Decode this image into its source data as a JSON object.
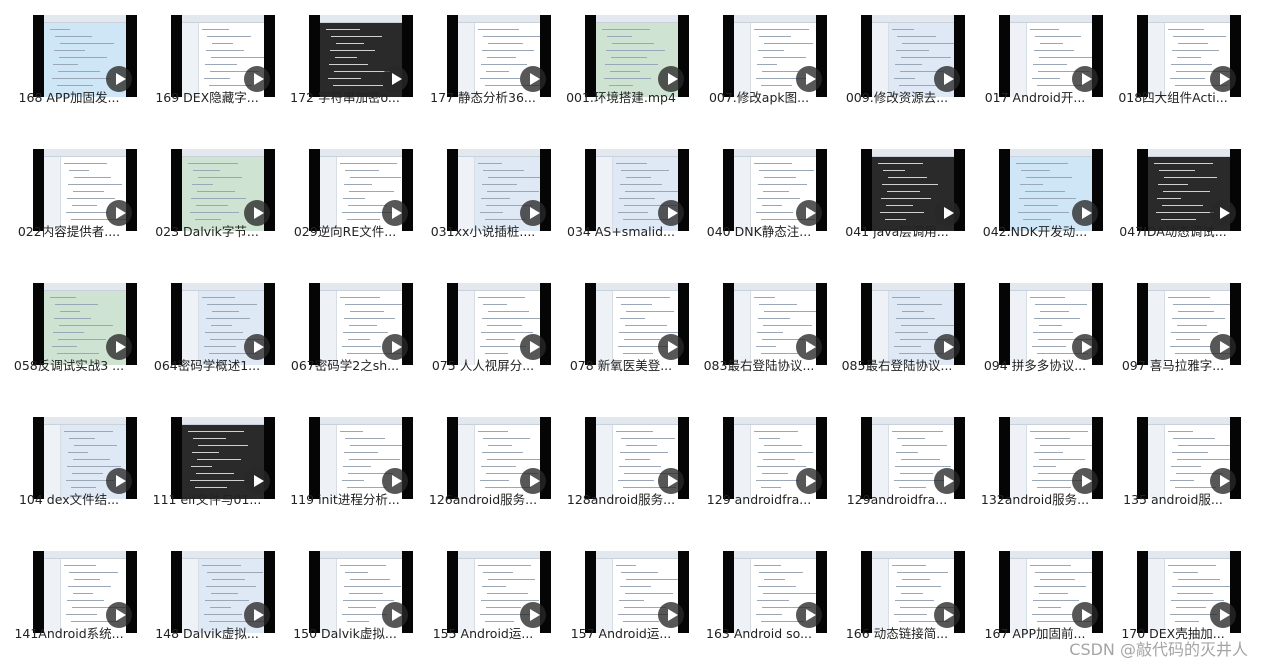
{
  "files": [
    {
      "caption": "168 APP加固发...",
      "variant": 5
    },
    {
      "caption": "169 DEX隐藏字...",
      "variant": 2
    },
    {
      "caption": "172 字符串加密o...",
      "variant": 4
    },
    {
      "caption": "177 静态分析36...",
      "variant": 2
    },
    {
      "caption": "001.环境搭建.mp4",
      "variant": 3
    },
    {
      "caption": "007.修改apk图...",
      "variant": 2
    },
    {
      "caption": "009.修改资源去...",
      "variant": 1
    },
    {
      "caption": "017 Android开...",
      "variant": 2
    },
    {
      "caption": "018四大组件Acti...",
      "variant": 2
    },
    {
      "caption": "022内容提供者....",
      "variant": 2
    },
    {
      "caption": "023 Dalvik字节...",
      "variant": 3
    },
    {
      "caption": "029逆向RE文件...",
      "variant": 2
    },
    {
      "caption": "031xx小说插桩....",
      "variant": 1
    },
    {
      "caption": "034 AS+smalid...",
      "variant": 1
    },
    {
      "caption": "040 DNK静态注...",
      "variant": 2
    },
    {
      "caption": "041 java层调用...",
      "variant": 4
    },
    {
      "caption": "042.NDK开发动...",
      "variant": 5
    },
    {
      "caption": "047IDA动态调试...",
      "variant": 4
    },
    {
      "caption": "058反调试实战3 ...",
      "variant": 3
    },
    {
      "caption": "064密码学概述1...",
      "variant": 1
    },
    {
      "caption": "067密码学2之sh...",
      "variant": 2
    },
    {
      "caption": "075 人人视屏分...",
      "variant": 2
    },
    {
      "caption": "078 新氧医美登...",
      "variant": 2
    },
    {
      "caption": "083最右登陆协议...",
      "variant": 2
    },
    {
      "caption": "085最右登陆协议...",
      "variant": 1
    },
    {
      "caption": "094 拼多多协议...",
      "variant": 2
    },
    {
      "caption": "097  喜马拉雅字...",
      "variant": 2
    },
    {
      "caption": "104 dex文件结...",
      "variant": 1
    },
    {
      "caption": "111 elf文件与01...",
      "variant": 4
    },
    {
      "caption": "119 init进程分析...",
      "variant": 2
    },
    {
      "caption": "126android服务...",
      "variant": 2
    },
    {
      "caption": "128android服务...",
      "variant": 2
    },
    {
      "caption": "129 androidfra...",
      "variant": 2
    },
    {
      "caption": "129androidfra...",
      "variant": 2
    },
    {
      "caption": "132android服务...",
      "variant": 2
    },
    {
      "caption": "135 android服...",
      "variant": 2
    },
    {
      "caption": "141Android系统...",
      "variant": 2
    },
    {
      "caption": "148 Dalvik虚拟...",
      "variant": 1
    },
    {
      "caption": "150 Dalvik虚拟...",
      "variant": 2
    },
    {
      "caption": "155 Android运...",
      "variant": 2
    },
    {
      "caption": "157 Android运...",
      "variant": 2
    },
    {
      "caption": "163 Android so...",
      "variant": 2
    },
    {
      "caption": "166 动态链接简...",
      "variant": 2
    },
    {
      "caption": "167 APP加固前...",
      "variant": 2
    },
    {
      "caption": "170 DEX壳抽加...",
      "variant": 2
    }
  ],
  "watermark": "CSDN @敲代码的灭井人"
}
